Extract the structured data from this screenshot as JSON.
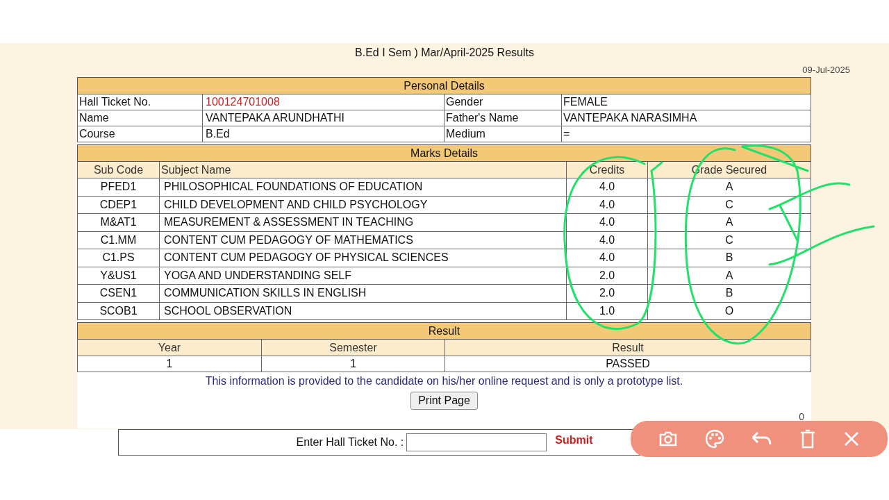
{
  "title": "B.Ed I Sem ) Mar/April-2025 Results",
  "date": "09-Jul-2025",
  "personal": {
    "heading": "Personal Details",
    "rows": [
      {
        "label": "Hall Ticket No.",
        "value": "100124701008",
        "label2": "Gender",
        "value2": "FEMALE"
      },
      {
        "label": "Name",
        "value": "VANTEPAKA ARUNDHATHI",
        "label2": "Father's Name",
        "value2": "VANTEPAKA NARASIMHA"
      },
      {
        "label": "Course",
        "value": "B.Ed",
        "label2": "Medium",
        "value2": "="
      }
    ]
  },
  "marks": {
    "heading": "Marks Details",
    "columns": [
      "Sub Code",
      "Subject Name",
      "Credits",
      "Grade Secured"
    ],
    "rows": [
      {
        "code": "PFED1",
        "subject": "PHILOSOPHICAL FOUNDATIONS OF EDUCATION",
        "credits": "4.0",
        "grade": "A"
      },
      {
        "code": "CDEP1",
        "subject": "CHILD DEVELOPMENT AND CHILD PSYCHOLOGY",
        "credits": "4.0",
        "grade": "C"
      },
      {
        "code": "M&AT1",
        "subject": "MEASUREMENT & ASSESSMENT IN TEACHING",
        "credits": "4.0",
        "grade": "A"
      },
      {
        "code": "C1.MM",
        "subject": "CONTENT CUM PEDAGOGY OF MATHEMATICS",
        "credits": "4.0",
        "grade": "C"
      },
      {
        "code": "C1.PS",
        "subject": "CONTENT CUM PEDAGOGY OF PHYSICAL SCIENCES",
        "credits": "4.0",
        "grade": "B"
      },
      {
        "code": "Y&US1",
        "subject": "YOGA AND UNDERSTANDING SELF",
        "credits": "2.0",
        "grade": "A"
      },
      {
        "code": "CSEN1",
        "subject": "COMMUNICATION SKILLS IN ENGLISH",
        "credits": "2.0",
        "grade": "B"
      },
      {
        "code": "SCOB1",
        "subject": "SCHOOL OBSERVATION",
        "credits": "1.0",
        "grade": "O"
      }
    ]
  },
  "result": {
    "heading": "Result",
    "columns": [
      "Year",
      "Semester",
      "Result"
    ],
    "row": [
      "1",
      "1",
      "PASSED"
    ]
  },
  "notice": "This information is provided to the candidate on his/her online request and is only a prototype list.",
  "print_button": "Print Page",
  "counter": "0",
  "form": {
    "label": "Enter Hall Ticket No. :",
    "submit": "Submit"
  }
}
